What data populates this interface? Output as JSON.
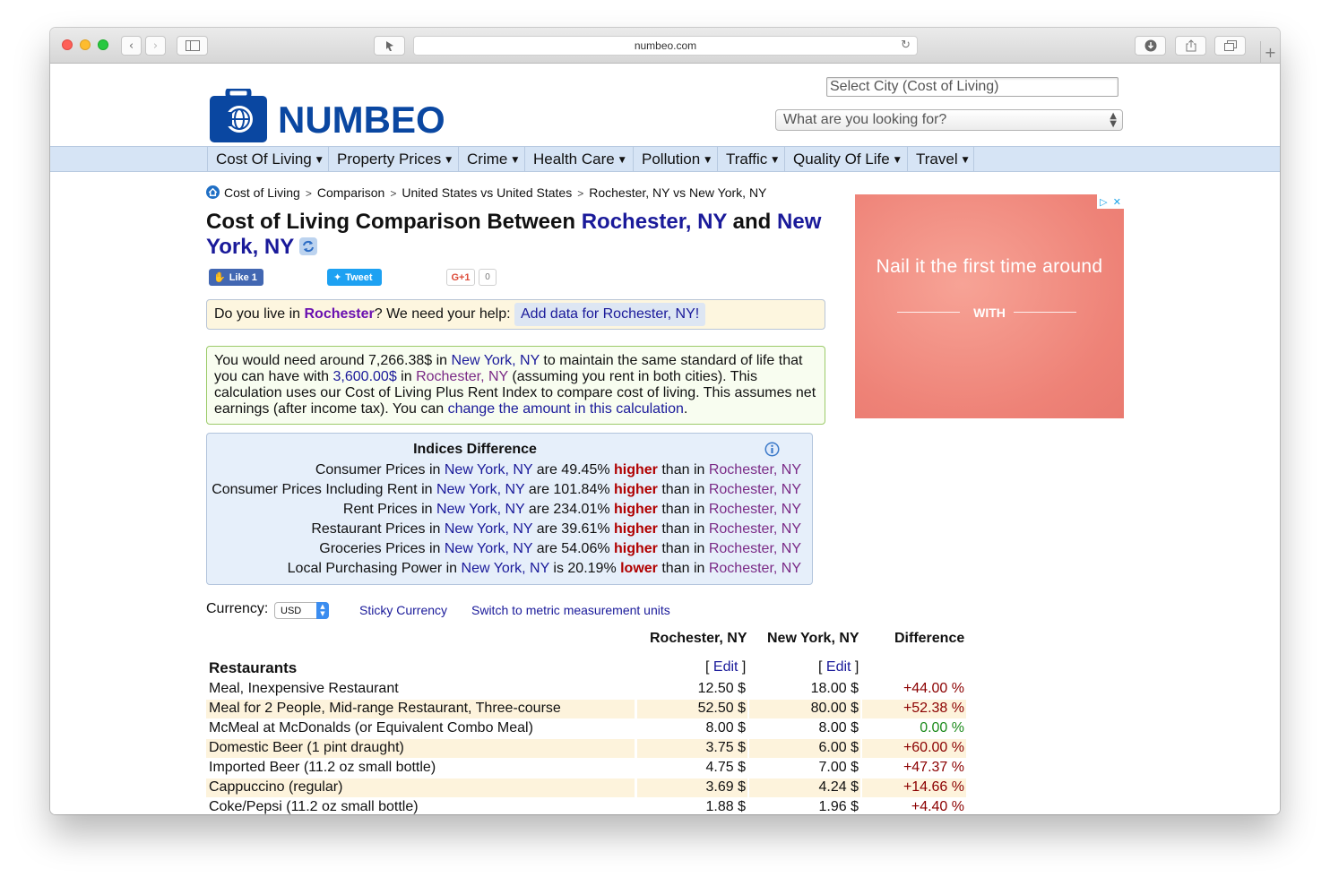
{
  "browser": {
    "url": "numbeo.com",
    "colors": {
      "close": "#fe5f57",
      "minimize": "#febc2e",
      "zoom": "#28c840"
    }
  },
  "header": {
    "logo_text": "NUMBEO",
    "select_city_placeholder": "Select City (Cost of Living)",
    "looking_for_placeholder": "What are you looking for?"
  },
  "nav": [
    {
      "label": "Cost Of Living"
    },
    {
      "label": "Property Prices"
    },
    {
      "label": "Crime"
    },
    {
      "label": "Health Care"
    },
    {
      "label": "Pollution"
    },
    {
      "label": "Traffic"
    },
    {
      "label": "Quality Of Life"
    },
    {
      "label": "Travel"
    }
  ],
  "breadcrumb": [
    "Cost of Living",
    "Comparison",
    "United States vs United States",
    "Rochester, NY vs New York, NY"
  ],
  "title": {
    "prefix": "Cost of Living Comparison Between ",
    "city1": "Rochester, NY",
    "mid": " and ",
    "city2": "New York, NY"
  },
  "social": {
    "like": "Like 1",
    "tweet": "Tweet",
    "gplus": "G+1",
    "gplus_count": "0"
  },
  "help": {
    "q1": "Do you live in ",
    "city": "Rochester",
    "q2": "? We need your help:",
    "button": "Add data for Rochester, NY!"
  },
  "need": {
    "t1": "You would need around 7,266.38$ in ",
    "ny": "New York, NY",
    "t2": " to maintain the same standard of life that you can have with ",
    "amount": "3,600.00$",
    "t3": " in ",
    "ro": "Rochester, NY",
    "t4": " (assuming you rent in both cities). This calculation uses our Cost of Living Plus Rent Index to compare cost of living. This assumes net earnings (after income tax). You can ",
    "link": "change the amount in this calculation",
    "t5": "."
  },
  "indices": {
    "title": "Indices Difference",
    "rows": [
      {
        "label": "Consumer Prices in ",
        "ny": "New York, NY",
        "mid": " are 49.45% ",
        "dir": "higher",
        "than": " than in ",
        "ro": "Rochester, NY"
      },
      {
        "label": "Consumer Prices Including Rent in ",
        "ny": "New York, NY",
        "mid": " are 101.84% ",
        "dir": "higher",
        "than": " than in ",
        "ro": "Rochester, NY"
      },
      {
        "label": "Rent Prices in ",
        "ny": "New York, NY",
        "mid": " are 234.01% ",
        "dir": "higher",
        "than": " than in ",
        "ro": "Rochester, NY"
      },
      {
        "label": "Restaurant Prices in ",
        "ny": "New York, NY",
        "mid": " are 39.61% ",
        "dir": "higher",
        "than": " than in ",
        "ro": "Rochester, NY"
      },
      {
        "label": "Groceries Prices in ",
        "ny": "New York, NY",
        "mid": " are 54.06% ",
        "dir": "higher",
        "than": " than in ",
        "ro": "Rochester, NY"
      },
      {
        "label": "Local Purchasing Power in ",
        "ny": "New York, NY",
        "mid": " is 20.19% ",
        "dir": "lower",
        "than": " than in ",
        "ro": "Rochester, NY"
      }
    ]
  },
  "currency": {
    "label": "Currency:",
    "value": "USD",
    "sticky": "Sticky Currency",
    "metric": "Switch to metric measurement units"
  },
  "table": {
    "headers": [
      "Rochester, NY",
      "New York, NY",
      "Difference"
    ],
    "category": "Restaurants",
    "edit": "Edit",
    "rows": [
      {
        "name": "Meal, Inexpensive Restaurant",
        "a": "12.50 $",
        "b": "18.00 $",
        "diff": "+44.00 %"
      },
      {
        "name": "Meal for 2 People, Mid-range Restaurant, Three-course",
        "a": "52.50 $",
        "b": "80.00 $",
        "diff": "+52.38 %"
      },
      {
        "name": "McMeal at McDonalds (or Equivalent Combo Meal)",
        "a": "8.00 $",
        "b": "8.00 $",
        "diff": "0.00 %"
      },
      {
        "name": "Domestic Beer (1 pint draught)",
        "a": "3.75 $",
        "b": "6.00 $",
        "diff": "+60.00 %"
      },
      {
        "name": "Imported Beer (11.2 oz small bottle)",
        "a": "4.75 $",
        "b": "7.00 $",
        "diff": "+47.37 %"
      },
      {
        "name": "Cappuccino (regular)",
        "a": "3.69 $",
        "b": "4.24 $",
        "diff": "+14.66 %"
      },
      {
        "name": "Coke/Pepsi (11.2 oz small bottle)",
        "a": "1.88 $",
        "b": "1.96 $",
        "diff": "+4.40 %"
      }
    ]
  },
  "ad": {
    "headline": "Nail it the first time around",
    "with": "WITH"
  }
}
